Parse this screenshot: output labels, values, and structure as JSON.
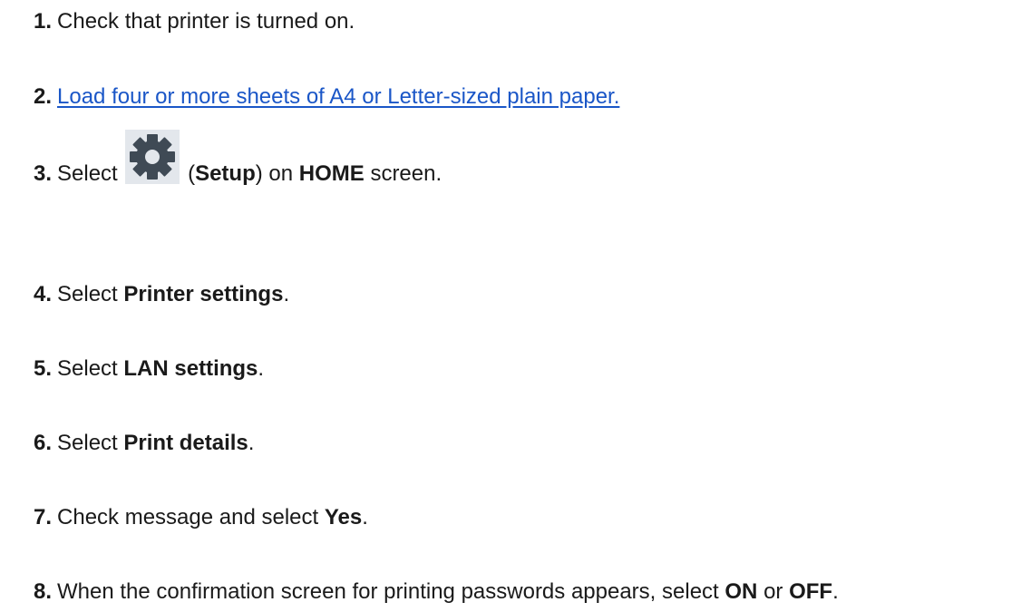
{
  "steps": [
    {
      "num": "1.",
      "text": "Check that printer is turned on."
    },
    {
      "num": "2.",
      "link": "Load four or more sheets of A4 or Letter-sized plain paper."
    },
    {
      "num": "3.",
      "pre": "Select",
      "paren_open": "(",
      "bold1": "Setup",
      "mid": ") on",
      "bold2": "HOME",
      "post": "screen.",
      "icon": "gear-icon"
    },
    {
      "num": "4.",
      "pre": "Select",
      "bold": "Printer settings",
      "post": "."
    },
    {
      "num": "5.",
      "pre": "Select",
      "bold": "LAN settings",
      "post": "."
    },
    {
      "num": "6.",
      "pre": "Select",
      "bold": "Print details",
      "post": "."
    },
    {
      "num": "7.",
      "pre": "Check message and select",
      "bold": "Yes",
      "post": "."
    },
    {
      "num": "8.",
      "pre": "When the confirmation screen for printing passwords appears, select",
      "bold1": "ON",
      "mid": "or",
      "bold2": "OFF",
      "post": "."
    }
  ],
  "colors": {
    "text": "#1a1a1a",
    "link": "#1a56c7",
    "gear": "#3f4a55",
    "gear_bg": "#e3e7ec"
  }
}
